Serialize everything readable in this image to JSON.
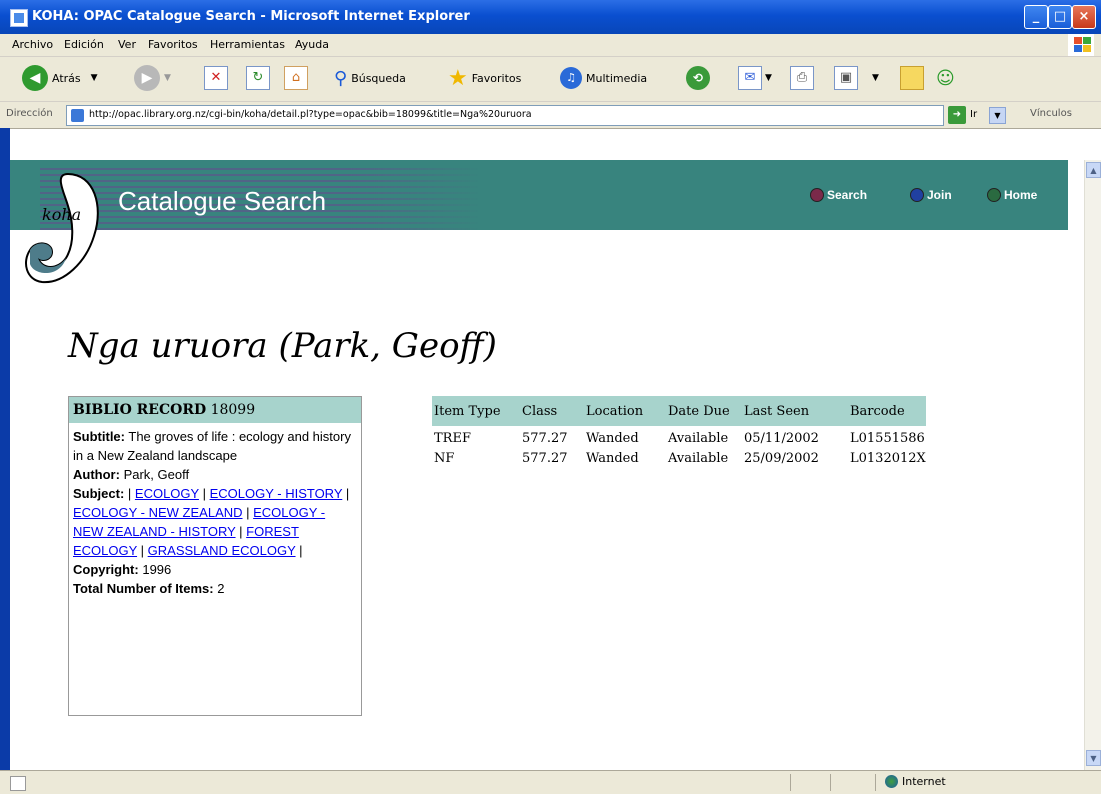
{
  "window": {
    "title": "KOHA: OPAC Catalogue Search - Microsoft Internet Explorer",
    "controls": [
      "minimize-icon",
      "maximize-icon",
      "close-icon"
    ]
  },
  "menu": [
    "Archivo",
    "Edición",
    "Ver",
    "Favoritos",
    "Herramientas",
    "Ayuda"
  ],
  "toolbar": {
    "back_label": "Atrás",
    "search_label": "Búsqueda",
    "favorites_label": "Favoritos",
    "multimedia_label": "Multimedia"
  },
  "address": {
    "label": "Dirección",
    "url": "http://opac.library.org.nz/cgi-bin/koha/detail.pl?type=opac&bib=18099&title=Nga%20uruora",
    "go_label": "Ir",
    "links_label": "Vínculos"
  },
  "banner": {
    "logo_text": "koha",
    "title": "Catalogue Search",
    "nav": [
      "Search",
      "Join",
      "Home"
    ]
  },
  "record": {
    "title": "Nga uruora (Park, Geoff)",
    "header_label": "BIBLIO RECORD",
    "number": "18099",
    "subtitle_label": "Subtitle:",
    "subtitle": "The groves of life : ecology and history in a New Zealand landscape",
    "author_label": "Author:",
    "author": "Park, Geoff",
    "subject_label": "Subject:",
    "subjects": [
      "ECOLOGY",
      "ECOLOGY - HISTORY",
      "ECOLOGY - NEW ZEALAND",
      "ECOLOGY - NEW ZEALAND - HISTORY",
      "FOREST ECOLOGY",
      "GRASSLAND ECOLOGY"
    ],
    "copyright_label": "Copyright:",
    "copyright": "1996",
    "total_label": "Total Number of Items:",
    "total": "2"
  },
  "items": {
    "columns": [
      "Item Type",
      "Class",
      "Location",
      "Date Due",
      "Last Seen",
      "Barcode"
    ],
    "rows": [
      [
        "TREF",
        "577.27",
        "Wanded",
        "Available",
        "05/11/2002",
        "L01551586"
      ],
      [
        "NF",
        "577.27",
        "Wanded",
        "Available",
        "25/09/2002",
        "L0132012X"
      ]
    ]
  },
  "status": {
    "zone": "Internet"
  }
}
